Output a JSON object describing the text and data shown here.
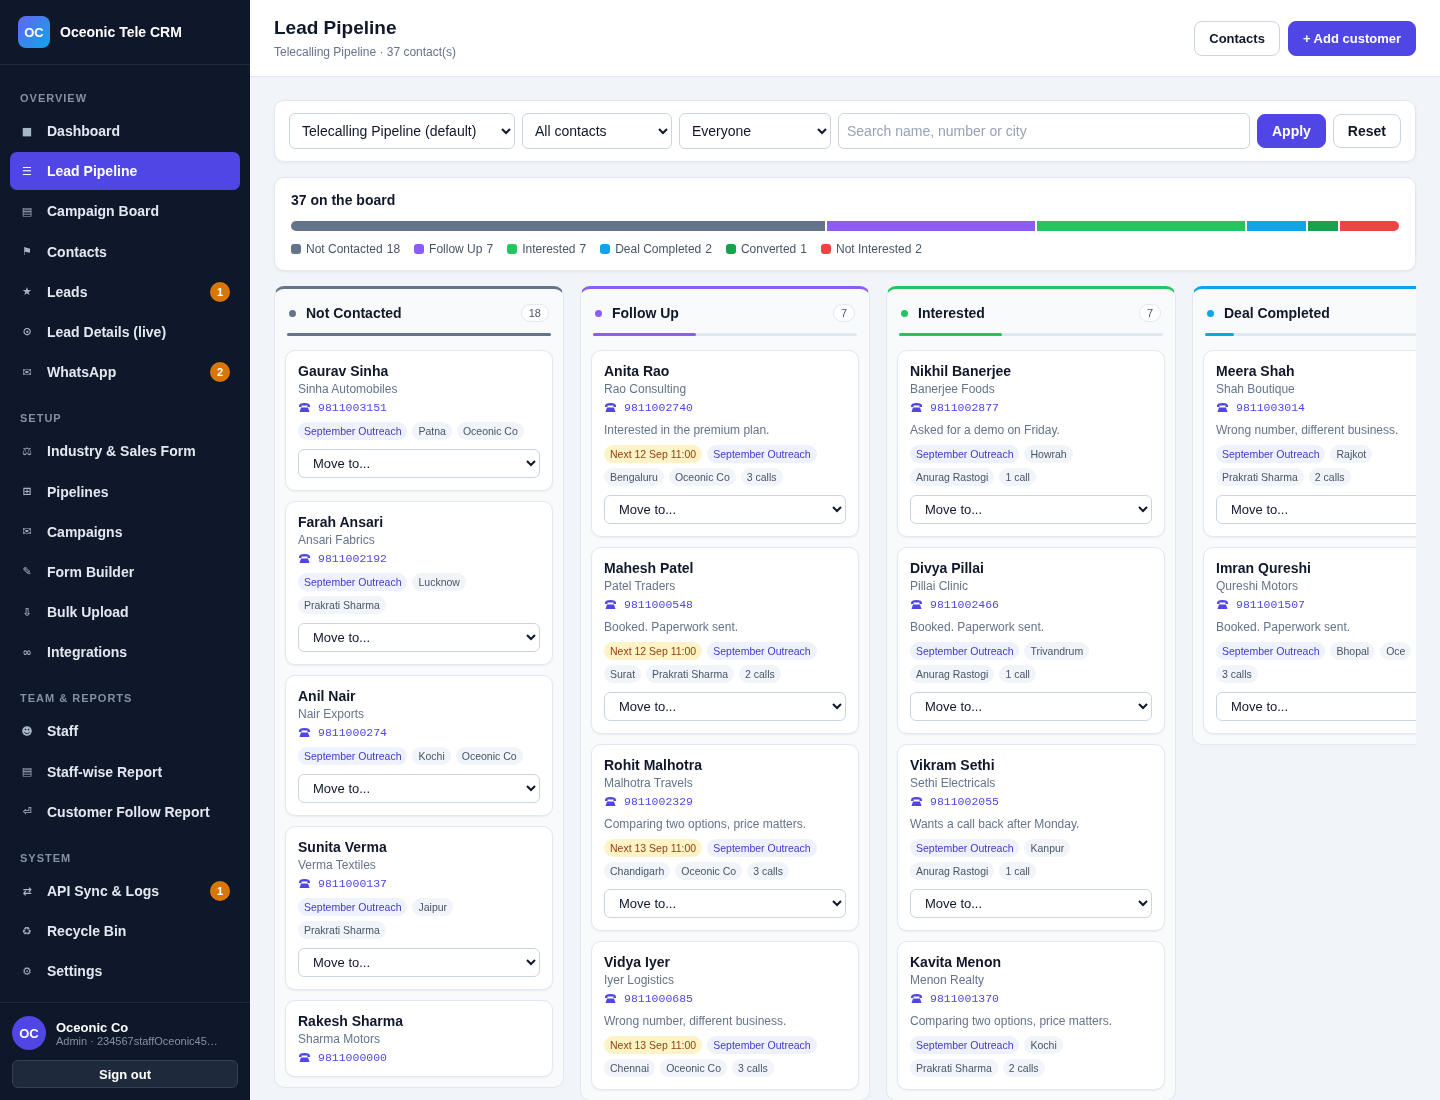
{
  "sidebar": {
    "brand": {
      "logo": "OC",
      "name": "Oceonic Tele CRM"
    },
    "sections": [
      {
        "title": "OVERVIEW",
        "items": [
          {
            "icon": "■",
            "label": "Dashboard",
            "selected": false
          },
          {
            "icon": "☰",
            "label": "Lead Pipeline",
            "selected": true
          },
          {
            "icon": "▤",
            "label": "Campaign Board",
            "selected": false
          },
          {
            "icon": "⚑",
            "label": "Contacts",
            "selected": false
          },
          {
            "icon": "★",
            "label": "Leads",
            "selected": false,
            "badge": "1"
          },
          {
            "icon": "⊙",
            "label": "Lead Details (live)",
            "selected": false
          },
          {
            "icon": "✉",
            "label": "WhatsApp",
            "selected": false,
            "badge": "2"
          }
        ]
      },
      {
        "title": "SETUP",
        "items": [
          {
            "icon": "⚖",
            "label": "Industry & Sales Form",
            "selected": false
          },
          {
            "icon": "⊞",
            "label": "Pipelines",
            "selected": false
          },
          {
            "icon": "✉",
            "label": "Campaigns",
            "selected": false
          },
          {
            "icon": "✎",
            "label": "Form Builder",
            "selected": false
          },
          {
            "icon": "⇩",
            "label": "Bulk Upload",
            "selected": false
          },
          {
            "icon": "∞",
            "label": "Integrations",
            "selected": false
          }
        ]
      },
      {
        "title": "TEAM & REPORTS",
        "items": [
          {
            "icon": "☻",
            "label": "Staff",
            "selected": false
          },
          {
            "icon": "▤",
            "label": "Staff-wise Report",
            "selected": false
          },
          {
            "icon": "⏎",
            "label": "Customer Follow Report",
            "selected": false
          }
        ]
      },
      {
        "title": "SYSTEM",
        "items": [
          {
            "icon": "⇄",
            "label": "API Sync & Logs",
            "selected": false,
            "badge": "1"
          },
          {
            "icon": "♻",
            "label": "Recycle Bin",
            "selected": false
          },
          {
            "icon": "⚙",
            "label": "Settings",
            "selected": false
          }
        ]
      }
    ],
    "user": {
      "avatar": "OC",
      "name": "Oceonic Co",
      "role": "Admin · 234567staffOceonic45…"
    },
    "sign_out": "Sign out"
  },
  "header": {
    "title": "Lead Pipeline",
    "subtitle": "Telecalling Pipeline · 37 contact(s)",
    "buttons": [
      {
        "label": "Contacts",
        "kind": "secondary"
      },
      {
        "label": "+ Add customer",
        "kind": "primary"
      }
    ]
  },
  "filters": {
    "selects": [
      "Telecalling Pipeline (default)",
      "All contacts",
      "Everyone"
    ],
    "search": {
      "placeholder": "Search name, number or city"
    },
    "buttons": [
      {
        "label": "Apply",
        "kind": "primary"
      },
      {
        "label": "Reset",
        "kind": "secondary"
      }
    ]
  },
  "summary": {
    "title": "37 on the board",
    "segments": [
      {
        "label": "Not Contacted",
        "count": "18",
        "color": "#64748b"
      },
      {
        "label": "Follow Up",
        "count": "7",
        "color": "#8b5cf6"
      },
      {
        "label": "Interested",
        "count": "7",
        "color": "#22c55e"
      },
      {
        "label": "Deal Completed",
        "count": "2",
        "color": "#0ea5e9"
      },
      {
        "label": "Converted",
        "count": "1",
        "color": "#16a34a"
      },
      {
        "label": "Not Interested",
        "count": "2",
        "color": "#ef4444"
      }
    ]
  },
  "columns": [
    {
      "name": "Not Contacted",
      "count": "18",
      "color": "#64748b",
      "level": 1,
      "cards": [
        {
          "name": "Gaurav Sinha",
          "company": "Sinha Automobiles",
          "phone": "9811003151",
          "tag_rows": [
            [
              {
                "text": "September Outreach",
                "kind": "campaign"
              },
              {
                "text": "Patna",
                "kind": "plain"
              },
              {
                "text": "Oceonic Co",
                "kind": "plain"
              }
            ]
          ],
          "move_label": "Move to..."
        },
        {
          "name": "Farah Ansari",
          "company": "Ansari Fabrics",
          "phone": "9811002192",
          "tag_rows": [
            [
              {
                "text": "September Outreach",
                "kind": "campaign"
              },
              {
                "text": "Lucknow",
                "kind": "plain"
              }
            ],
            [
              {
                "text": "Prakrati Sharma",
                "kind": "plain"
              }
            ]
          ],
          "move_label": "Move to..."
        },
        {
          "name": "Anil Nair",
          "company": "Nair Exports",
          "phone": "9811000274",
          "tag_rows": [
            [
              {
                "text": "September Outreach",
                "kind": "campaign"
              },
              {
                "text": "Kochi",
                "kind": "plain"
              },
              {
                "text": "Oceonic Co",
                "kind": "plain"
              }
            ]
          ],
          "move_label": "Move to..."
        },
        {
          "name": "Sunita Verma",
          "company": "Verma Textiles",
          "phone": "9811000137",
          "tag_rows": [
            [
              {
                "text": "September Outreach",
                "kind": "campaign"
              },
              {
                "text": "Jaipur",
                "kind": "plain"
              }
            ],
            [
              {
                "text": "Prakrati Sharma",
                "kind": "plain"
              }
            ]
          ],
          "move_label": "Move to..."
        },
        {
          "name": "Rakesh Sharma",
          "company": "Sharma Motors",
          "phone": "9811000000"
        }
      ]
    },
    {
      "name": "Follow Up",
      "count": "7",
      "color": "#8b5cf6",
      "level": 0.39,
      "cards": [
        {
          "name": "Anita Rao",
          "company": "Rao Consulting",
          "phone": "9811002740",
          "note": "Interested in the premium plan.",
          "tag_rows": [
            [
              {
                "text": "Next 12 Sep 11:00",
                "kind": "next"
              },
              {
                "text": "September Outreach",
                "kind": "campaign"
              }
            ],
            [
              {
                "text": "Bengaluru",
                "kind": "plain"
              },
              {
                "text": "Oceonic Co",
                "kind": "plain"
              },
              {
                "text": "3 calls",
                "kind": "plain"
              }
            ]
          ],
          "move_label": "Move to..."
        },
        {
          "name": "Mahesh Patel",
          "company": "Patel Traders",
          "phone": "9811000548",
          "note": "Booked. Paperwork sent.",
          "tag_rows": [
            [
              {
                "text": "Next 12 Sep 11:00",
                "kind": "next"
              },
              {
                "text": "September Outreach",
                "kind": "campaign"
              }
            ],
            [
              {
                "text": "Surat",
                "kind": "plain"
              },
              {
                "text": "Prakrati Sharma",
                "kind": "plain"
              },
              {
                "text": "2 calls",
                "kind": "plain"
              }
            ]
          ],
          "move_label": "Move to..."
        },
        {
          "name": "Rohit Malhotra",
          "company": "Malhotra Travels",
          "phone": "9811002329",
          "note": "Comparing two options, price matters.",
          "tag_rows": [
            [
              {
                "text": "Next 13 Sep 11:00",
                "kind": "next"
              },
              {
                "text": "September Outreach",
                "kind": "campaign"
              }
            ],
            [
              {
                "text": "Chandigarh",
                "kind": "plain"
              },
              {
                "text": "Oceonic Co",
                "kind": "plain"
              },
              {
                "text": "3 calls",
                "kind": "plain"
              }
            ]
          ],
          "move_label": "Move to..."
        },
        {
          "name": "Vidya Iyer",
          "company": "Iyer Logistics",
          "phone": "9811000685",
          "note": "Wrong number, different business.",
          "tag_rows": [
            [
              {
                "text": "Next 13 Sep 11:00",
                "kind": "next"
              },
              {
                "text": "September Outreach",
                "kind": "campaign"
              }
            ],
            [
              {
                "text": "Chennai",
                "kind": "plain"
              },
              {
                "text": "Oceonic Co",
                "kind": "plain"
              },
              {
                "text": "3 calls",
                "kind": "plain"
              }
            ]
          ]
        }
      ]
    },
    {
      "name": "Interested",
      "count": "7",
      "color": "#22c55e",
      "level": 0.39,
      "cards": [
        {
          "name": "Nikhil Banerjee",
          "company": "Banerjee Foods",
          "phone": "9811002877",
          "note": "Asked for a demo on Friday.",
          "tag_rows": [
            [
              {
                "text": "September Outreach",
                "kind": "campaign"
              },
              {
                "text": "Howrah",
                "kind": "plain"
              }
            ],
            [
              {
                "text": "Anurag Rastogi",
                "kind": "plain"
              },
              {
                "text": "1 call",
                "kind": "plain"
              }
            ]
          ],
          "move_label": "Move to..."
        },
        {
          "name": "Divya Pillai",
          "company": "Pillai Clinic",
          "phone": "9811002466",
          "note": "Booked. Paperwork sent.",
          "tag_rows": [
            [
              {
                "text": "September Outreach",
                "kind": "campaign"
              },
              {
                "text": "Trivandrum",
                "kind": "plain"
              }
            ],
            [
              {
                "text": "Anurag Rastogi",
                "kind": "plain"
              },
              {
                "text": "1 call",
                "kind": "plain"
              }
            ]
          ],
          "move_label": "Move to..."
        },
        {
          "name": "Vikram Sethi",
          "company": "Sethi Electricals",
          "phone": "9811002055",
          "note": "Wants a call back after Monday.",
          "tag_rows": [
            [
              {
                "text": "September Outreach",
                "kind": "campaign"
              },
              {
                "text": "Kanpur",
                "kind": "plain"
              }
            ],
            [
              {
                "text": "Anurag Rastogi",
                "kind": "plain"
              },
              {
                "text": "1 call",
                "kind": "plain"
              }
            ]
          ],
          "move_label": "Move to..."
        },
        {
          "name": "Kavita Menon",
          "company": "Menon Realty",
          "phone": "9811001370",
          "note": "Comparing two options, price matters.",
          "tag_rows": [
            [
              {
                "text": "September Outreach",
                "kind": "campaign"
              },
              {
                "text": "Kochi",
                "kind": "plain"
              }
            ],
            [
              {
                "text": "Prakrati Sharma",
                "kind": "plain"
              },
              {
                "text": "2 calls",
                "kind": "plain"
              }
            ]
          ]
        }
      ]
    },
    {
      "name": "Deal Completed",
      "color": "#0ea5e9",
      "level": 0.11,
      "cards": [
        {
          "name": "Meera Shah",
          "company": "Shah Boutique",
          "phone": "9811003014",
          "note": "Wrong number, different business.",
          "tag_rows": [
            [
              {
                "text": "September Outreach",
                "kind": "campaign"
              },
              {
                "text": "Rajkot",
                "kind": "plain"
              }
            ],
            [
              {
                "text": "Prakrati Sharma",
                "kind": "plain"
              },
              {
                "text": "2 calls",
                "kind": "plain"
              }
            ]
          ],
          "move_label": "Move to..."
        },
        {
          "name": "Imran Qureshi",
          "company": "Qureshi Motors",
          "phone": "9811001507",
          "note": "Booked. Paperwork sent.",
          "tag_rows": [
            [
              {
                "text": "September Outreach",
                "kind": "campaign"
              },
              {
                "text": "Bhopal",
                "kind": "plain"
              },
              {
                "text": "Oce",
                "kind": "plain"
              }
            ],
            [
              {
                "text": "3 calls",
                "kind": "plain"
              }
            ]
          ],
          "move_label": "Move to..."
        }
      ]
    }
  ]
}
